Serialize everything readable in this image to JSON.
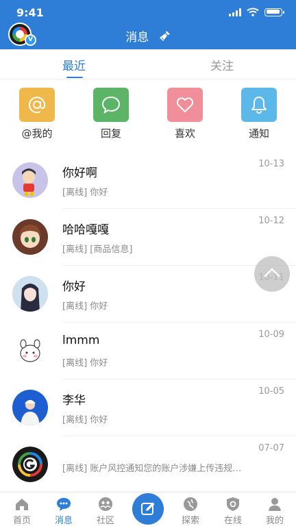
{
  "status_bar": {
    "time": "9:41"
  },
  "header": {
    "title": "消息"
  },
  "tabs": [
    {
      "label": "最近"
    },
    {
      "label": "关注"
    }
  ],
  "quick_actions": [
    {
      "label": "@我的",
      "icon": "at-icon",
      "color": "#f0b84a"
    },
    {
      "label": "回复",
      "icon": "comment-icon",
      "color": "#5cb466"
    },
    {
      "label": "喜欢",
      "icon": "heart-icon",
      "color": "#f08e99"
    },
    {
      "label": "通知",
      "icon": "bell-icon",
      "color": "#5bb8e8"
    }
  ],
  "messages": [
    {
      "name": "你好啊",
      "preview": "[离线] 你好",
      "date": "10-13"
    },
    {
      "name": "哈哈嘎嘎",
      "preview": "[离线] [商品信息]",
      "date": "10-12"
    },
    {
      "name": "你好",
      "preview": "[离线] 你好",
      "date": "10-11"
    },
    {
      "name": "lmmm",
      "preview": "[离线] 你好",
      "date": "10-09"
    },
    {
      "name": "李华",
      "preview": "[离线] 你好",
      "date": "10-05"
    },
    {
      "name": "",
      "preview": "[离线] 账户风控通知您的账户涉嫌上传违规…",
      "date": "07-07"
    }
  ],
  "bottom_nav": [
    {
      "label": "首页",
      "icon": "home-icon"
    },
    {
      "label": "消息",
      "icon": "chat-icon"
    },
    {
      "label": "社区",
      "icon": "community-icon"
    },
    {
      "label": "",
      "icon": "compose-icon"
    },
    {
      "label": "探索",
      "icon": "explore-icon"
    },
    {
      "label": "在线",
      "icon": "online-icon"
    },
    {
      "label": "我的",
      "icon": "profile-icon"
    }
  ],
  "colors": {
    "primary": "#2e7dd6"
  }
}
